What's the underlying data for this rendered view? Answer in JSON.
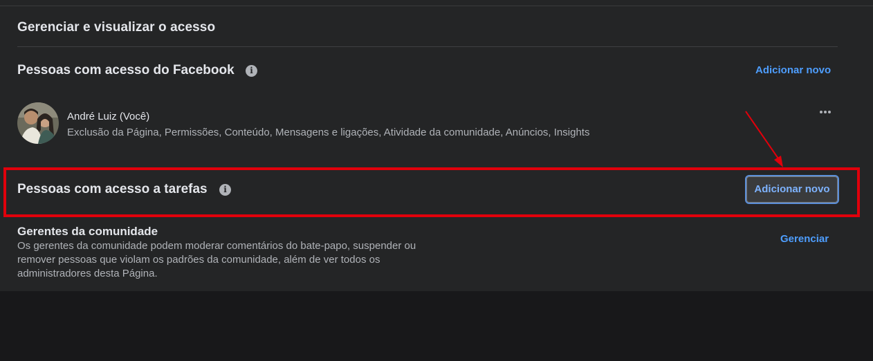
{
  "header": {
    "title": "Gerenciar e visualizar o acesso"
  },
  "facebook_access": {
    "title": "Pessoas com acesso do Facebook",
    "info_icon": "info-icon",
    "add_label": "Adicionar novo",
    "people": [
      {
        "name": "André Luiz (Você)",
        "permissions": "Exclusão da Página, Permissões, Conteúdo, Mensagens e ligações, Atividade da comunidade, Anúncios, Insights",
        "more_icon": "more-options-icon"
      }
    ]
  },
  "task_access": {
    "title": "Pessoas com acesso a tarefas",
    "info_icon": "info-icon",
    "add_label": "Adicionar novo"
  },
  "community_managers": {
    "title": "Gerentes da comunidade",
    "description": "Os gerentes da comunidade podem moderar comentários do bate-papo, suspender ou remover pessoas que violam os padrões da comunidade, além de ver todos os administradores desta Página.",
    "manage_label": "Gerenciar"
  },
  "colors": {
    "background": "#242526",
    "link": "#4e9eff",
    "annotation": "#e0000b"
  }
}
